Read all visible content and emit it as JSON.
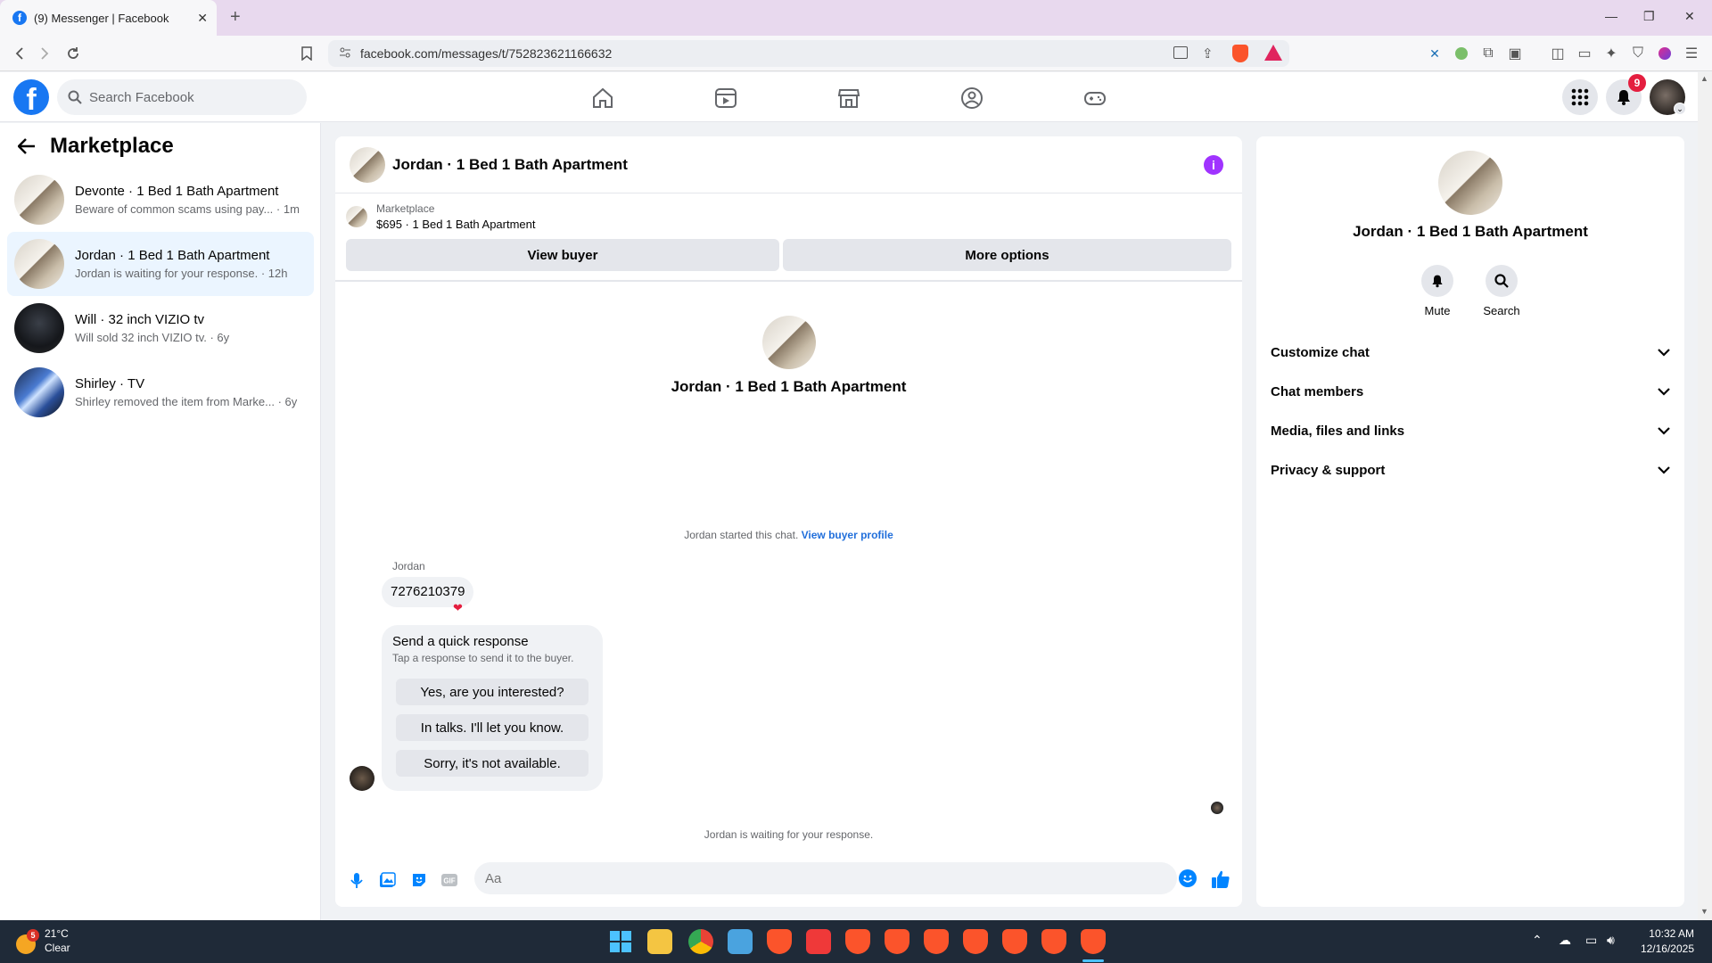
{
  "browser": {
    "tab_title": "(9) Messenger | Facebook",
    "url": "facebook.com/messages/t/752823621166632"
  },
  "fb": {
    "search_placeholder": "Search Facebook",
    "notification_count": "9"
  },
  "left": {
    "title": "Marketplace",
    "conversations": [
      {
        "name": "Devonte · 1 Bed 1 Bath Apartment",
        "preview": "Beware of common scams using pay... · 1m",
        "active": false
      },
      {
        "name": "Jordan · 1 Bed 1 Bath Apartment",
        "preview": "Jordan is waiting for your response. · 12h",
        "active": true
      },
      {
        "name": "Will · 32 inch VIZIO tv",
        "preview": "Will sold 32 inch VIZIO tv. · 6y",
        "active": false
      },
      {
        "name": "Shirley · TV",
        "preview": "Shirley removed the item from Marke... · 6y",
        "active": false
      }
    ]
  },
  "chat": {
    "title": "Jordan · 1 Bed 1 Bath Apartment",
    "marketplace_label": "Marketplace",
    "listing": "$695 · 1 Bed 1 Bath Apartment",
    "view_buyer": "View buyer",
    "more_options": "More options",
    "profile_name": "Jordan · 1 Bed 1 Bath Apartment",
    "started_text": "Jordan started this chat.",
    "view_buyer_profile": "View buyer profile",
    "sender": "Jordan",
    "message": "7276210379",
    "quick_title": "Send a quick response",
    "quick_sub": "Tap a response to send it to the buyer.",
    "quick_responses": [
      "Yes, are you interested?",
      "In talks. I'll let you know.",
      "Sorry, it's not available."
    ],
    "waiting": "Jordan is waiting for your response.",
    "input_placeholder": "Aa"
  },
  "right": {
    "name": "Jordan · 1 Bed 1 Bath Apartment",
    "mute": "Mute",
    "search": "Search",
    "sections": [
      "Customize chat",
      "Chat members",
      "Media, files and links",
      "Privacy & support"
    ]
  },
  "taskbar": {
    "weather_temp": "21°C",
    "weather_desc": "Clear",
    "weather_badge": "5",
    "time": "10:32 AM",
    "date": "12/16/2025"
  },
  "colors": {
    "fb_blue": "#1877f2",
    "messenger_blue": "#0084ff",
    "active_bg": "#ebf5ff",
    "info_purple": "#a033ff"
  }
}
